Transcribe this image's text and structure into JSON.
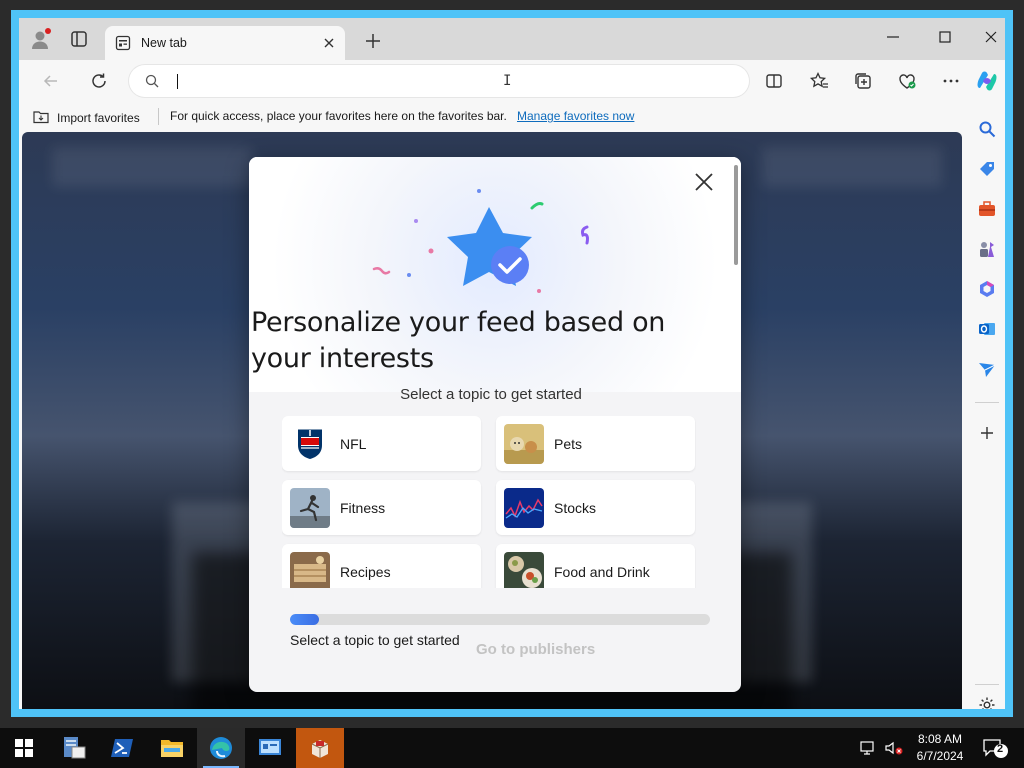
{
  "browser": {
    "tab": {
      "title": "New tab"
    },
    "address": {
      "value": "",
      "placeholder": ""
    },
    "favorites_bar": {
      "import_label": "Import favorites",
      "hint": "For quick access, place your favorites here on the favorites bar.",
      "manage_link": "Manage favorites now"
    }
  },
  "modal": {
    "title": "Personalize your feed based on your interests",
    "subtitle": "Select a topic to get started",
    "topics": [
      {
        "label": "NFL",
        "icon": "nfl-logo"
      },
      {
        "label": "Pets",
        "icon": "pets-thumbnail"
      },
      {
        "label": "Fitness",
        "icon": "fitness-thumbnail"
      },
      {
        "label": "Stocks",
        "icon": "stocks-thumbnail"
      },
      {
        "label": "Recipes",
        "icon": "recipes-thumbnail"
      },
      {
        "label": "Food and Drink",
        "icon": "food-thumbnail"
      }
    ],
    "progress": {
      "fraction": 0.07,
      "label": "Select a topic to get started"
    },
    "next_button": "Go to publishers"
  },
  "taskbar": {
    "clock": {
      "time": "8:08 AM",
      "date": "6/7/2024"
    },
    "notifications_count": "2"
  },
  "colors": {
    "accent": "#0f6cbd",
    "window_border": "#4fc3f7",
    "progress_fill": "#3a6de3",
    "active_taskbar": "#c2570f"
  }
}
